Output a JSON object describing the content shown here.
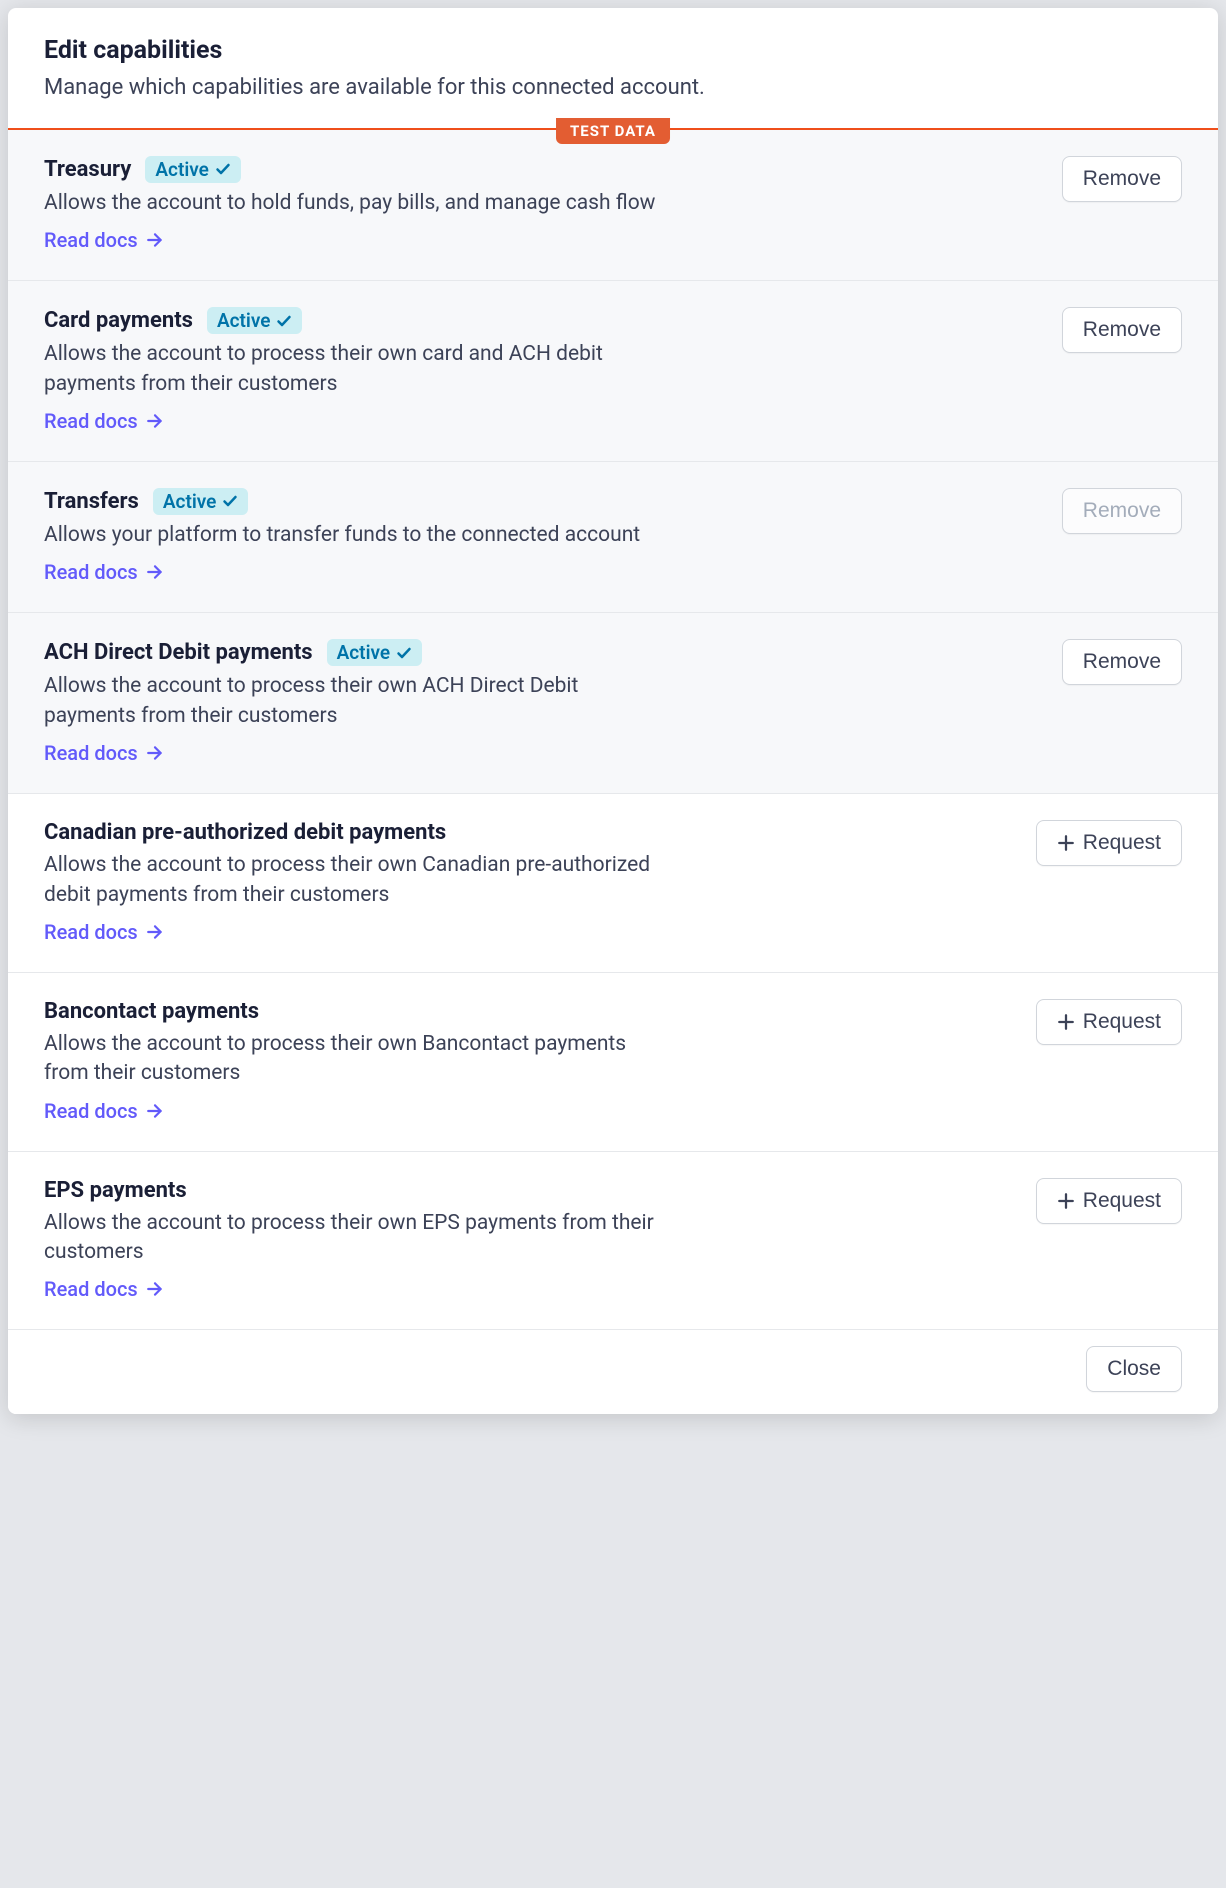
{
  "header": {
    "title": "Edit capabilities",
    "subtitle": "Manage which capabilities are available for this connected account."
  },
  "test_badge": "TEST DATA",
  "active_label": "Active",
  "remove_label": "Remove",
  "request_label": "Request",
  "read_docs_label": "Read docs",
  "close_label": "Close",
  "capabilities": [
    {
      "name": "Treasury",
      "description": "Allows the account to hold funds, pay bills, and manage cash flow",
      "active": true,
      "action": "remove",
      "disabled": false
    },
    {
      "name": "Card payments",
      "description": "Allows the account to process their own card and ACH debit payments from their customers",
      "active": true,
      "action": "remove",
      "disabled": false
    },
    {
      "name": "Transfers",
      "description": "Allows your platform to transfer funds to the connected account",
      "active": true,
      "action": "remove",
      "disabled": true
    },
    {
      "name": "ACH Direct Debit payments",
      "description": "Allows the account to process their own ACH Direct Debit payments from their customers",
      "active": true,
      "action": "remove",
      "disabled": false
    },
    {
      "name": "Canadian pre-authorized debit payments",
      "description": "Allows the account to process their own Canadian pre-authorized debit payments from their customers",
      "active": false,
      "action": "request",
      "disabled": false
    },
    {
      "name": "Bancontact payments",
      "description": "Allows the account to process their own Bancontact payments from their customers",
      "active": false,
      "action": "request",
      "disabled": false
    },
    {
      "name": "EPS payments",
      "description": "Allows the account to process their own EPS payments from their customers",
      "active": false,
      "action": "request",
      "disabled": false
    }
  ]
}
